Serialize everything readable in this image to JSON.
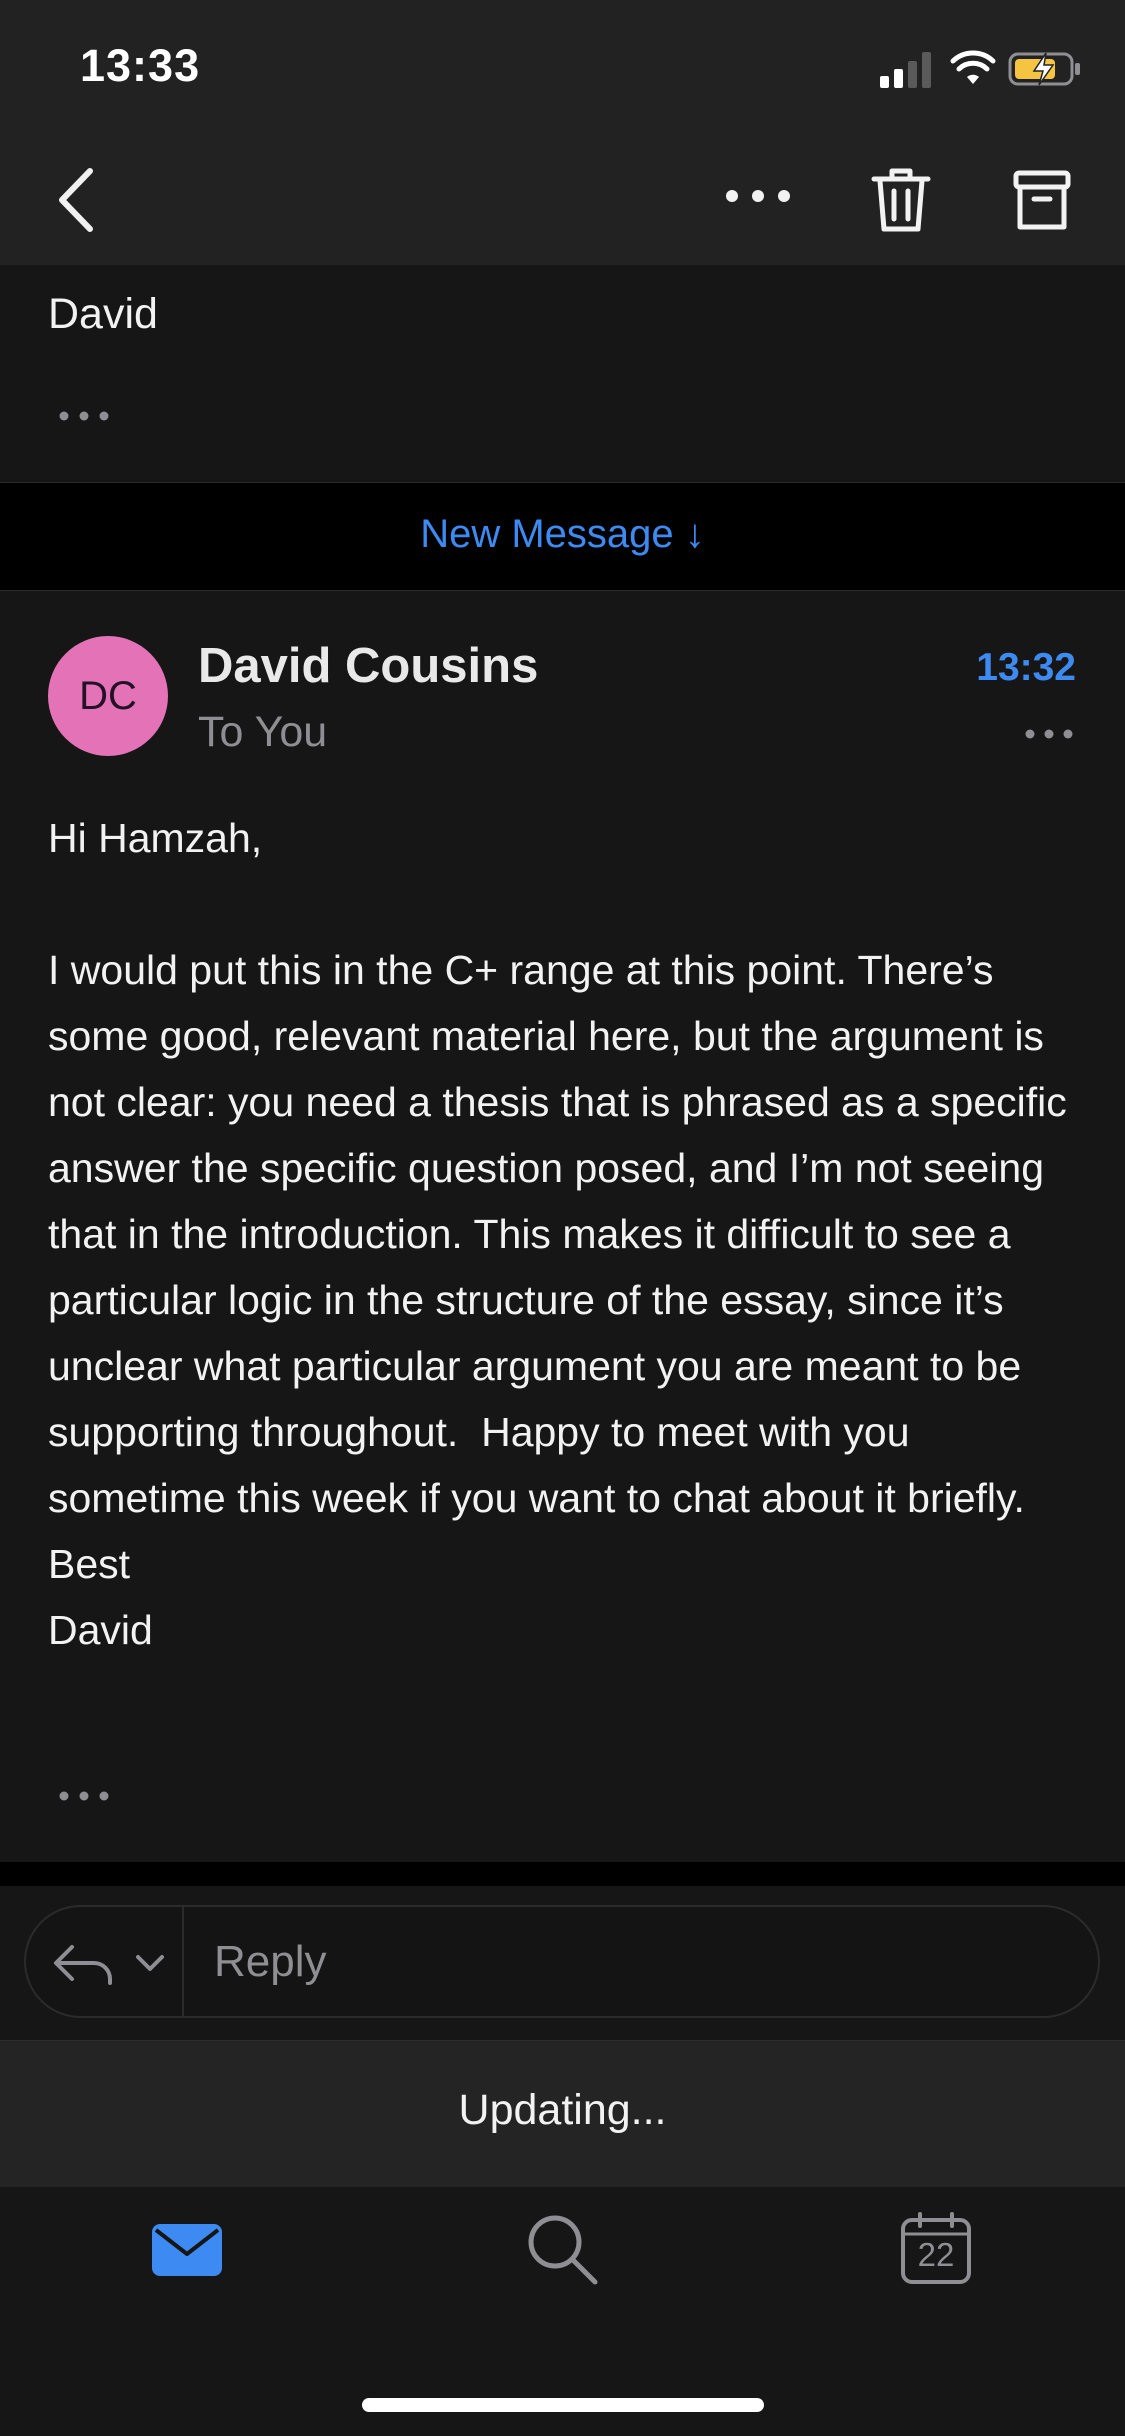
{
  "status": {
    "time": "13:33"
  },
  "previous": {
    "signature": "David"
  },
  "banner": {
    "label": "New Message ↓"
  },
  "message": {
    "avatar_initials": "DC",
    "avatar_color": "#e372b7",
    "sender": "David Cousins",
    "recipient": "To You",
    "time": "13:32",
    "body": "Hi Hamzah,\n\nI would put this in the C+ range at this point. There’s some good, relevant material here, but the argument is not clear: you need a thesis that is phrased as a specific answer the specific question posed, and I’m not seeing that in the introduction. This makes it difficult to see a particular logic in the structure of the essay, since it’s unclear what particular argument you are meant to be supporting throughout.  Happy to meet with you sometime this week if you want to chat about it briefly.\nBest\nDavid"
  },
  "reply": {
    "placeholder": "Reply"
  },
  "sync": {
    "status": "Updating..."
  },
  "tabs": {
    "calendar_day": "22"
  },
  "colors": {
    "accent": "#3d8bf2",
    "background": "#161616",
    "battery": "#f5c542"
  },
  "icons": [
    "back-icon",
    "more-icon",
    "trash-icon",
    "archive-icon",
    "reply-icon",
    "chevron-down-icon",
    "mail-icon",
    "search-icon",
    "calendar-icon"
  ]
}
